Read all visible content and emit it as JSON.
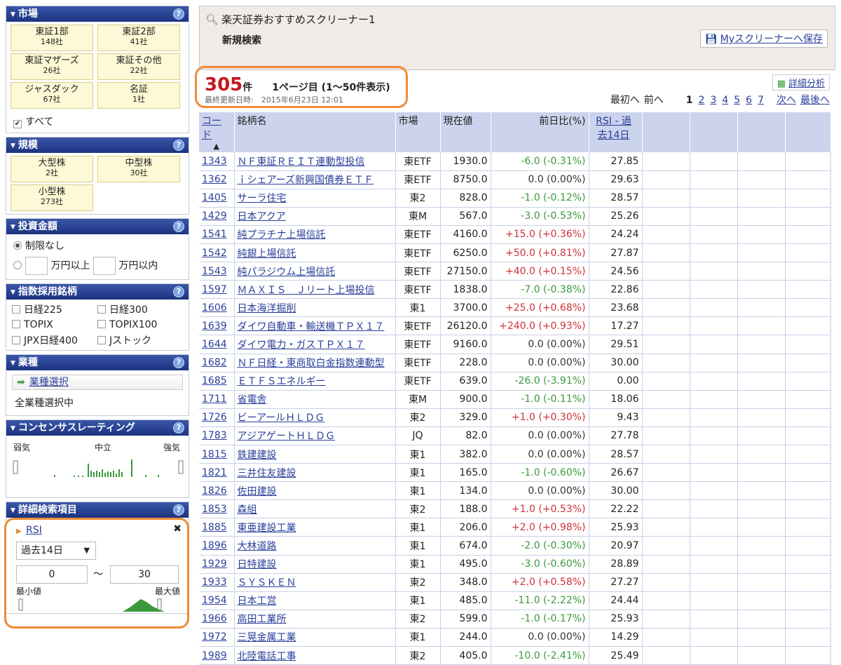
{
  "sidebar": {
    "market": {
      "title": "市場",
      "tiles": [
        {
          "name": "東証1部",
          "count": "148社"
        },
        {
          "name": "東証2部",
          "count": "41社"
        },
        {
          "name": "東証マザーズ",
          "count": "26社"
        },
        {
          "name": "東証その他",
          "count": "22社"
        },
        {
          "name": "ジャスダック",
          "count": "67社"
        },
        {
          "name": "名証",
          "count": "1社"
        }
      ],
      "all_label": "すべて"
    },
    "scale": {
      "title": "規模",
      "tiles": [
        {
          "name": "大型株",
          "count": "2社"
        },
        {
          "name": "中型株",
          "count": "30社"
        },
        {
          "name": "小型株",
          "count": "273社"
        }
      ]
    },
    "investment": {
      "title": "投資金額",
      "unlimited": "制限なし",
      "min_suffix": "万円以上",
      "max_suffix": "万円以内"
    },
    "index": {
      "title": "指数採用銘柄",
      "items": [
        "日経225",
        "日経300",
        "TOPIX",
        "TOPIX100",
        "JPX日経400",
        "Jストック"
      ]
    },
    "industry": {
      "title": "業種",
      "button": "業種選択",
      "status": "全業種選択中"
    },
    "consensus": {
      "title": "コンセンサスレーティング",
      "weak": "弱気",
      "neutral": "中立",
      "strong": "強気"
    },
    "detail": {
      "title": "詳細検索項目",
      "item": "RSI",
      "period": "過去14日",
      "min_value": "0",
      "max_value": "30",
      "tilde": "〜",
      "min_label": "最小値",
      "max_label": "最大値"
    }
  },
  "header": {
    "title": "楽天証券おすすめスクリーナー1",
    "subtitle": "新規検索",
    "save_label": "Myスクリーナーへ保存"
  },
  "results": {
    "count": "305",
    "count_unit": "件",
    "page_info": "1ページ目 (1〜50件表示)",
    "updated": "最終更新日時:　2015年6月23日 12:01",
    "detail_button": "詳細分析",
    "pager": {
      "first": "最初へ",
      "prev": "前へ",
      "pages": [
        "1",
        "2",
        "3",
        "4",
        "5",
        "6",
        "7"
      ],
      "next": "次へ",
      "last": "最後へ"
    }
  },
  "table": {
    "headers": {
      "code": "コード",
      "sort": "▲",
      "name": "銘柄名",
      "market": "市場",
      "price": "現在値",
      "change": "前日比(%)",
      "rsi": "RSI - 過去14日"
    },
    "rows": [
      [
        "1343",
        "ＮＦ東証ＲＥＩＴ連動型投信",
        "東ETF",
        "1930.0",
        "-6.0 (-0.31%)",
        "27.85"
      ],
      [
        "1362",
        "ｉシェアーズ新興国債券ＥＴＦ",
        "東ETF",
        "8750.0",
        "0.0 (0.00%)",
        "29.63"
      ],
      [
        "1405",
        "サーラ住宅",
        "東2",
        "828.0",
        "-1.0 (-0.12%)",
        "28.57"
      ],
      [
        "1429",
        "日本アクア",
        "東M",
        "567.0",
        "-3.0 (-0.53%)",
        "25.26"
      ],
      [
        "1541",
        "純プラチナ上場信託",
        "東ETF",
        "4160.0",
        "+15.0 (+0.36%)",
        "24.24"
      ],
      [
        "1542",
        "純銀上場信託",
        "東ETF",
        "6250.0",
        "+50.0 (+0.81%)",
        "27.87"
      ],
      [
        "1543",
        "純パラジウム上場信託",
        "東ETF",
        "27150.0",
        "+40.0 (+0.15%)",
        "24.56"
      ],
      [
        "1597",
        "ＭＡＸＩＳ　Ｊリート上場投信",
        "東ETF",
        "1838.0",
        "-7.0 (-0.38%)",
        "22.86"
      ],
      [
        "1606",
        "日本海洋掘削",
        "東1",
        "3700.0",
        "+25.0 (+0.68%)",
        "23.68"
      ],
      [
        "1639",
        "ダイワ自動車・輸送機ＴＰＸ１７",
        "東ETF",
        "26120.0",
        "+240.0 (+0.93%)",
        "17.27"
      ],
      [
        "1644",
        "ダイワ電力・ガスＴＰＸ１７",
        "東ETF",
        "9160.0",
        "0.0 (0.00%)",
        "29.51"
      ],
      [
        "1682",
        "ＮＦ日経・東商取白金指数連動型",
        "東ETF",
        "228.0",
        "0.0 (0.00%)",
        "30.00"
      ],
      [
        "1685",
        "ＥＴＦＳエネルギー",
        "東ETF",
        "639.0",
        "-26.0 (-3.91%)",
        "0.00"
      ],
      [
        "1711",
        "省電舎",
        "東M",
        "900.0",
        "-1.0 (-0.11%)",
        "18.06"
      ],
      [
        "1726",
        "ビーアールＨＬＤＧ",
        "東2",
        "329.0",
        "+1.0 (+0.30%)",
        "9.43"
      ],
      [
        "1783",
        "アジアゲートＨＬＤＧ",
        "JQ",
        "82.0",
        "0.0 (0.00%)",
        "27.78"
      ],
      [
        "1815",
        "鉄建建設",
        "東1",
        "382.0",
        "0.0 (0.00%)",
        "28.57"
      ],
      [
        "1821",
        "三井住友建設",
        "東1",
        "165.0",
        "-1.0 (-0.60%)",
        "26.67"
      ],
      [
        "1826",
        "佐田建設",
        "東1",
        "134.0",
        "0.0 (0.00%)",
        "30.00"
      ],
      [
        "1853",
        "森組",
        "東2",
        "188.0",
        "+1.0 (+0.53%)",
        "22.22"
      ],
      [
        "1885",
        "東亜建設工業",
        "東1",
        "206.0",
        "+2.0 (+0.98%)",
        "25.93"
      ],
      [
        "1896",
        "大林道路",
        "東1",
        "674.0",
        "-2.0 (-0.30%)",
        "20.97"
      ],
      [
        "1929",
        "日特建設",
        "東1",
        "495.0",
        "-3.0 (-0.60%)",
        "28.89"
      ],
      [
        "1933",
        "ＳＹＳＫＥＮ",
        "東2",
        "348.0",
        "+2.0 (+0.58%)",
        "27.27"
      ],
      [
        "1954",
        "日本工営",
        "東1",
        "485.0",
        "-11.0 (-2.22%)",
        "24.44"
      ],
      [
        "1966",
        "高田工業所",
        "東2",
        "599.0",
        "-1.0 (-0.17%)",
        "25.93"
      ],
      [
        "1972",
        "三晃金属工業",
        "東1",
        "244.0",
        "0.0 (0.00%)",
        "14.29"
      ],
      [
        "1989",
        "北陸電話工事",
        "東2",
        "405.0",
        "-10.0 (-2.41%)",
        "25.49"
      ]
    ]
  },
  "colors": {
    "header_bar": "#1b3480",
    "tile_bg": "#fdf8d5",
    "highlight": "#ef8a36",
    "count_red": "#c8161d",
    "positive": "#d0323b",
    "negative": "#3a9a3a"
  }
}
